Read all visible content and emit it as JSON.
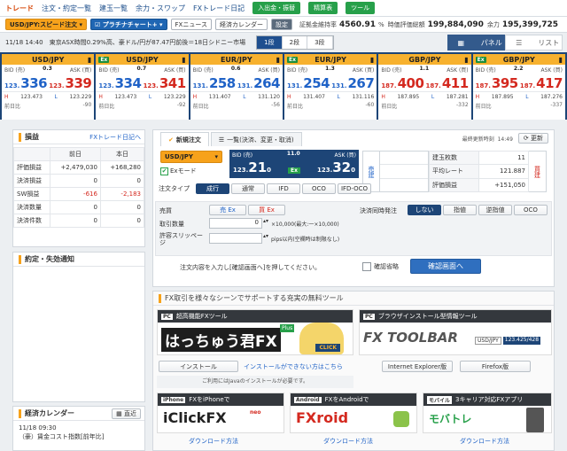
{
  "nav": {
    "items": [
      "トレード",
      "注文・約定一覧",
      "建玉一覧",
      "余力・スワップ",
      "FXトレード日記"
    ],
    "btn_deposit": "入出金・振替",
    "btn_settle": "精算表",
    "btn_tools": "ツール"
  },
  "toolbar": {
    "speed_order": "USD/JPY:スピード注文",
    "platinum": "プラチナチャート+",
    "fx_news": "FXニュース",
    "calendar": "経済カレンダー",
    "settings": "設定",
    "margin_ratio_label": "証拠金維持率",
    "margin_ratio": "4560.91",
    "valuation_label": "時価評価総額",
    "valuation": "199,884,090",
    "surplus_label": "余力",
    "surplus": "195,399,725"
  },
  "ticker": {
    "text": "11/18 14:40　東京ASX時間0.29%高、豪ドル/円が87.47円前後＝18日シドニー市場"
  },
  "layout_seg": [
    "1段",
    "2段",
    "3段"
  ],
  "view": {
    "panel": "パネル",
    "list": "リスト"
  },
  "rates": [
    {
      "pair": "USD/JPY",
      "ex": "",
      "spread": "0.3",
      "bid_small": "123.",
      "bid_big": "336",
      "ask_small": "123.",
      "ask_big": "339",
      "high": "123.473",
      "low": "123.229",
      "prev_label": "前日比",
      "prev": "-90"
    },
    {
      "pair": "USD/JPY",
      "ex": "Ex",
      "spread": "0.7",
      "bid_small": "123.",
      "bid_big": "334",
      "ask_small": "123.",
      "ask_big": "341",
      "high": "123.473",
      "low": "123.229",
      "prev_label": "前日比",
      "prev": "-92"
    },
    {
      "pair": "EUR/JPY",
      "ex": "",
      "spread": "0.6",
      "bid_small": "131.",
      "bid_big": "258",
      "ask_small": "131.",
      "ask_big": "264",
      "high": "131.407",
      "low": "131.120",
      "prev_label": "前日比",
      "prev": "-56"
    },
    {
      "pair": "EUR/JPY",
      "ex": "Ex",
      "spread": "1.3",
      "bid_small": "131.",
      "bid_big": "254",
      "ask_small": "131.",
      "ask_big": "267",
      "high": "131.407",
      "low": "131.116",
      "prev_label": "前日比",
      "prev": "-60"
    },
    {
      "pair": "GBP/JPY",
      "ex": "",
      "spread": "1.1",
      "bid_small": "187.",
      "bid_big": "400",
      "ask_small": "187.",
      "ask_big": "411",
      "high": "187.895",
      "low": "187.281",
      "prev_label": "前日比",
      "prev": "-332"
    },
    {
      "pair": "GBP/JPY",
      "ex": "Ex",
      "spread": "2.2",
      "bid_small": "187.",
      "bid_big": "395",
      "ask_small": "187.",
      "ask_big": "417",
      "high": "187.895",
      "low": "187.276",
      "prev_label": "前日比",
      "prev": "-337"
    }
  ],
  "pl": {
    "title": "損益",
    "diary": "FXトレード日記へ",
    "col_prev": "前日",
    "col_today": "本日",
    "rows": [
      {
        "label": "評価損益",
        "prev": "+2,479,030",
        "today": "+168,280"
      },
      {
        "label": "決済損益",
        "prev": "0",
        "today": "0"
      },
      {
        "label": "SW損益",
        "prev": "-616",
        "today": "-2,183"
      },
      {
        "label": "決済数量",
        "prev": "0",
        "today": "0"
      },
      {
        "label": "決済件数",
        "prev": "0",
        "today": "0"
      }
    ]
  },
  "notify": {
    "title": "約定・失効通知"
  },
  "econ": {
    "title": "経済カレンダー",
    "btn": "直近",
    "date": "11/18 09:30",
    "item": "（豪）賃金コスト指数[前年比]"
  },
  "order": {
    "tab_new": "新規注文",
    "tab_list": "一覧(決済、変更・取消)",
    "last_update_label": "最終更新時刻",
    "last_update": "14:49",
    "refresh": "更新",
    "pair": "USD/JPY",
    "ex_mode": "Exモード",
    "bid_label": "BID (売)",
    "spread": "11.0",
    "ask_label": "ASK (買)",
    "bid_small": "123.",
    "bid_big": "21",
    "bid_tail": "0",
    "ask_small": "123.",
    "ask_big": "32",
    "ask_tail": "0",
    "ex_badge": "Ex",
    "side_sell": "売建",
    "side_buy": "買建",
    "pos_rows": [
      {
        "label": "建玉枚数",
        "val": "11"
      },
      {
        "label": "平均レート",
        "val": "121.887"
      },
      {
        "label": "評価損益",
        "val": "+151,050"
      }
    ],
    "type_label": "注文タイプ",
    "types": [
      "成行",
      "通常",
      "IFD",
      "OCO",
      "IFD-OCO"
    ],
    "sellbuy_label": "売買",
    "sell_ex": "売 Ex",
    "buy_ex": "買 Ex",
    "qty_label": "取引数量",
    "qty": "0",
    "qty_note": "×10,000(最大:一×10,000)",
    "slip_label": "許容スリッページ",
    "slip_note": "pips以内(空欄時は制限なし)",
    "simul_label": "決済同時発注",
    "simul": [
      "しない",
      "指値",
      "逆指値",
      "OCO"
    ],
    "hint": "注文内容を入力し[確認画面へ]を押してください。",
    "skip": "確認省略",
    "confirm": "確認画面へ"
  },
  "promo": {
    "title": "FX取引を様々なシーンでサポートする充実の無料ツール",
    "pc1": "超高機能FXツール",
    "hachi": "はっちゅう君FX",
    "plus": "Plus",
    "click": "CLICK",
    "install": "インストール",
    "cant_install": "インストールができない方はこちら",
    "java_note": "ご利用にはJavaのインストールが必要です。",
    "pc2": "ブラウザインストール型情報ツール",
    "fx_toolbar": "FX TOOLBAR",
    "tb_pair": "USD/JPY",
    "tb_rate": "123.425/428",
    "ie": "Internet Explorer版",
    "ff": "Firefox版",
    "iphone_tag": "iPhone",
    "iphone": "FXをiPhoneで",
    "iclick": "iClickFX",
    "neo": "neo",
    "android_tag": "Android",
    "android": "FXをAndroidで",
    "fxroid": "FXroid",
    "mobile_tag": "モバイル",
    "mobile": "3キャリア対応FXアプリ",
    "mobatore": "モバトレ",
    "download": "ダウンロード方法"
  }
}
